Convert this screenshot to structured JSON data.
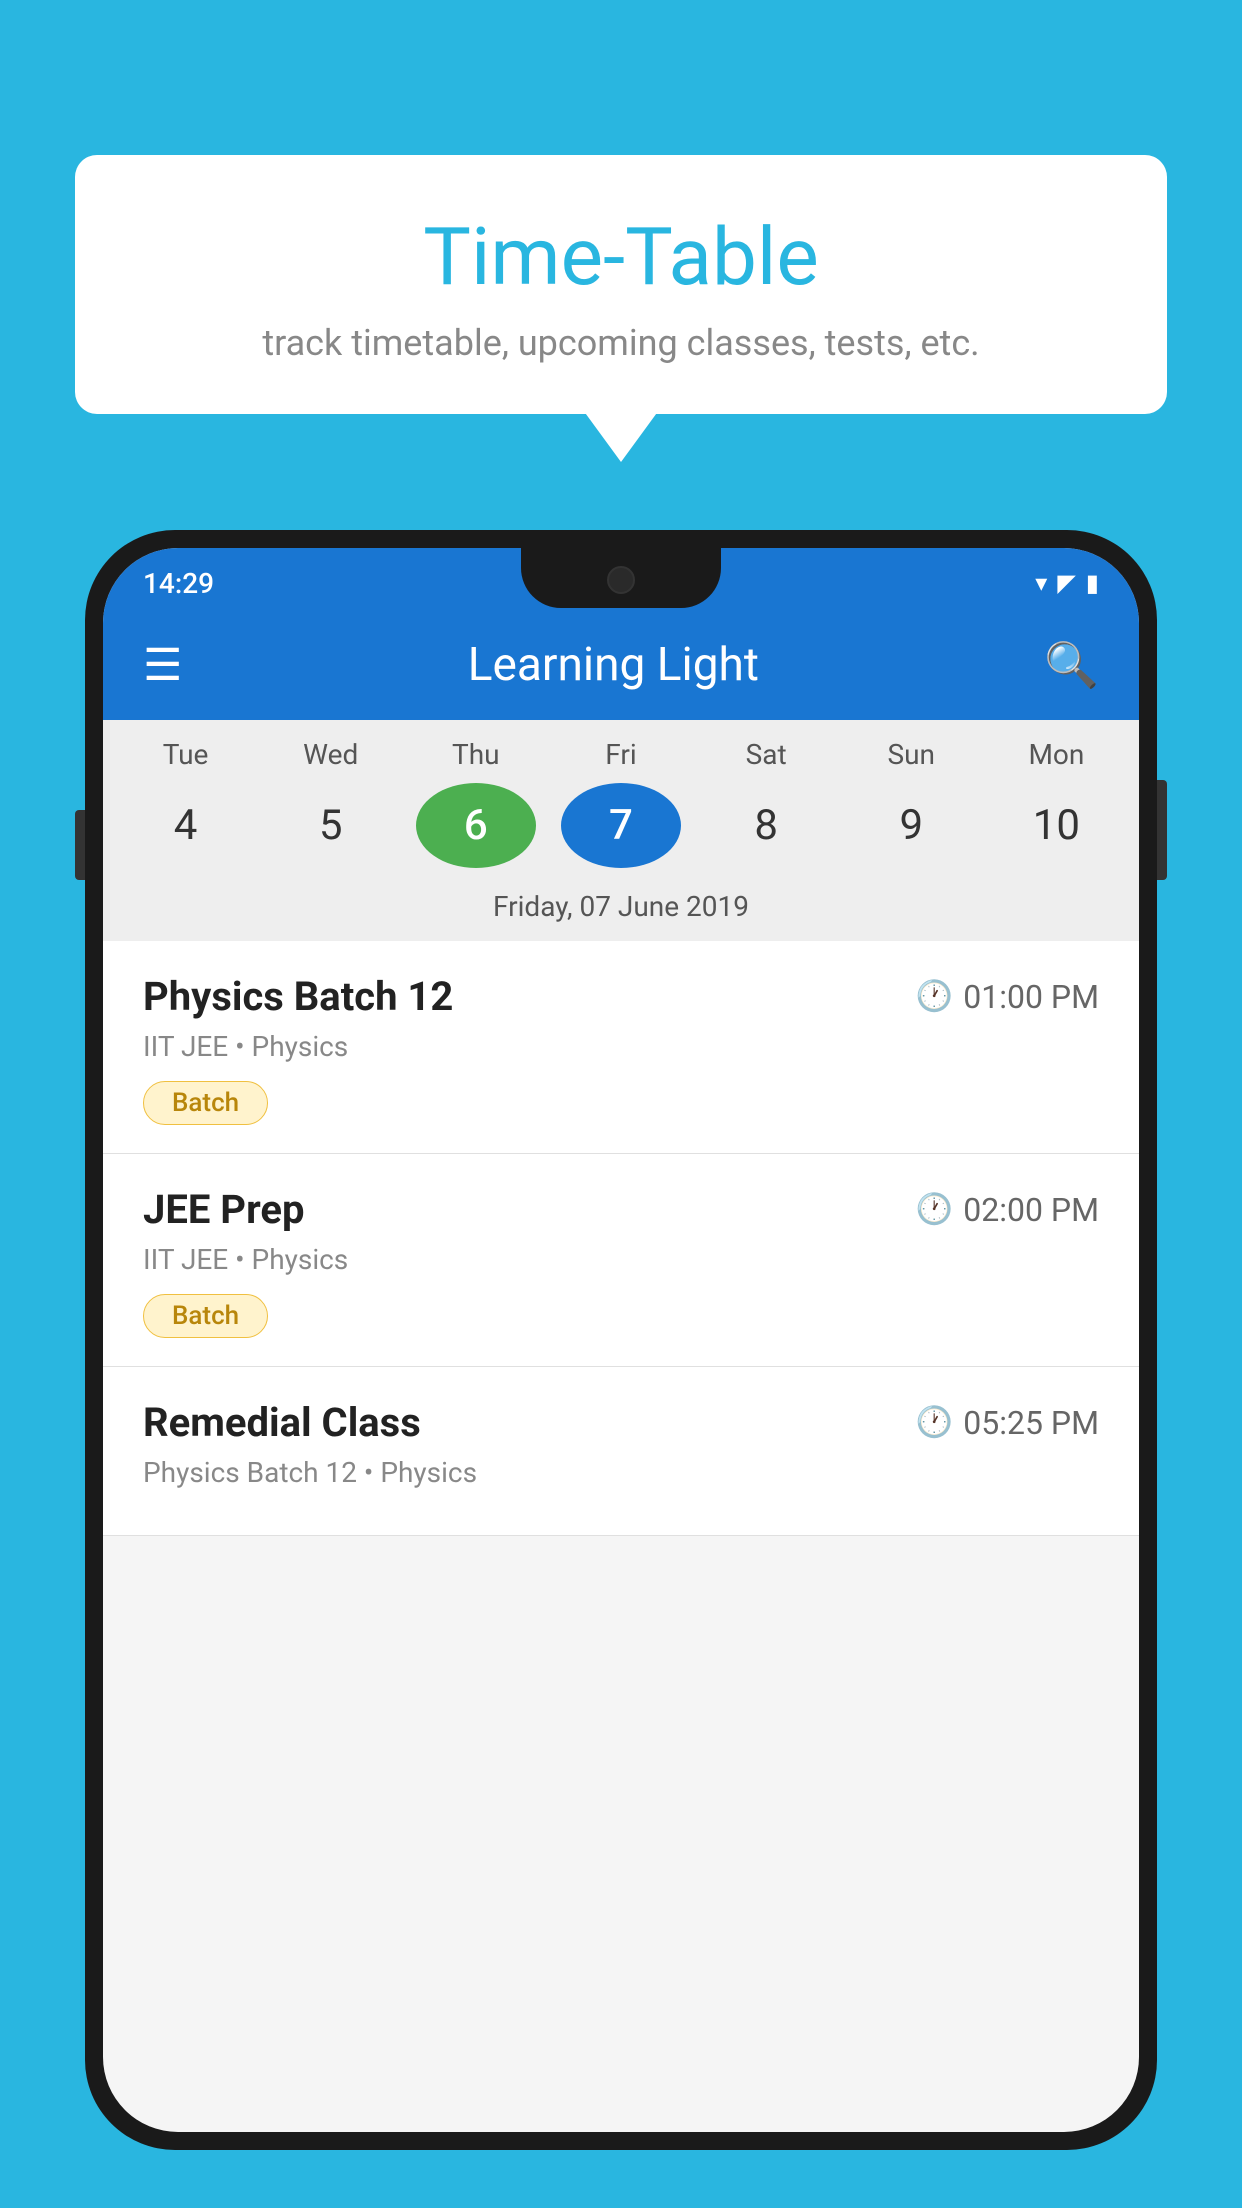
{
  "background_color": "#29B6E0",
  "bubble": {
    "title": "Time-Table",
    "subtitle": "track timetable, upcoming classes, tests, etc."
  },
  "phone": {
    "status_bar": {
      "time": "14:29"
    },
    "app_bar": {
      "title": "Learning Light"
    },
    "calendar": {
      "days": [
        {
          "day": "Tue",
          "num": "4",
          "state": "normal"
        },
        {
          "day": "Wed",
          "num": "5",
          "state": "normal"
        },
        {
          "day": "Thu",
          "num": "6",
          "state": "today"
        },
        {
          "day": "Fri",
          "num": "7",
          "state": "selected"
        },
        {
          "day": "Sat",
          "num": "8",
          "state": "normal"
        },
        {
          "day": "Sun",
          "num": "9",
          "state": "normal"
        },
        {
          "day": "Mon",
          "num": "10",
          "state": "normal"
        }
      ],
      "selected_date_label": "Friday, 07 June 2019"
    },
    "schedule_items": [
      {
        "title": "Physics Batch 12",
        "time": "01:00 PM",
        "subtitle": "IIT JEE • Physics",
        "badge": "Batch"
      },
      {
        "title": "JEE Prep",
        "time": "02:00 PM",
        "subtitle": "IIT JEE • Physics",
        "badge": "Batch"
      },
      {
        "title": "Remedial Class",
        "time": "05:25 PM",
        "subtitle": "Physics Batch 12 • Physics",
        "badge": null
      }
    ]
  }
}
